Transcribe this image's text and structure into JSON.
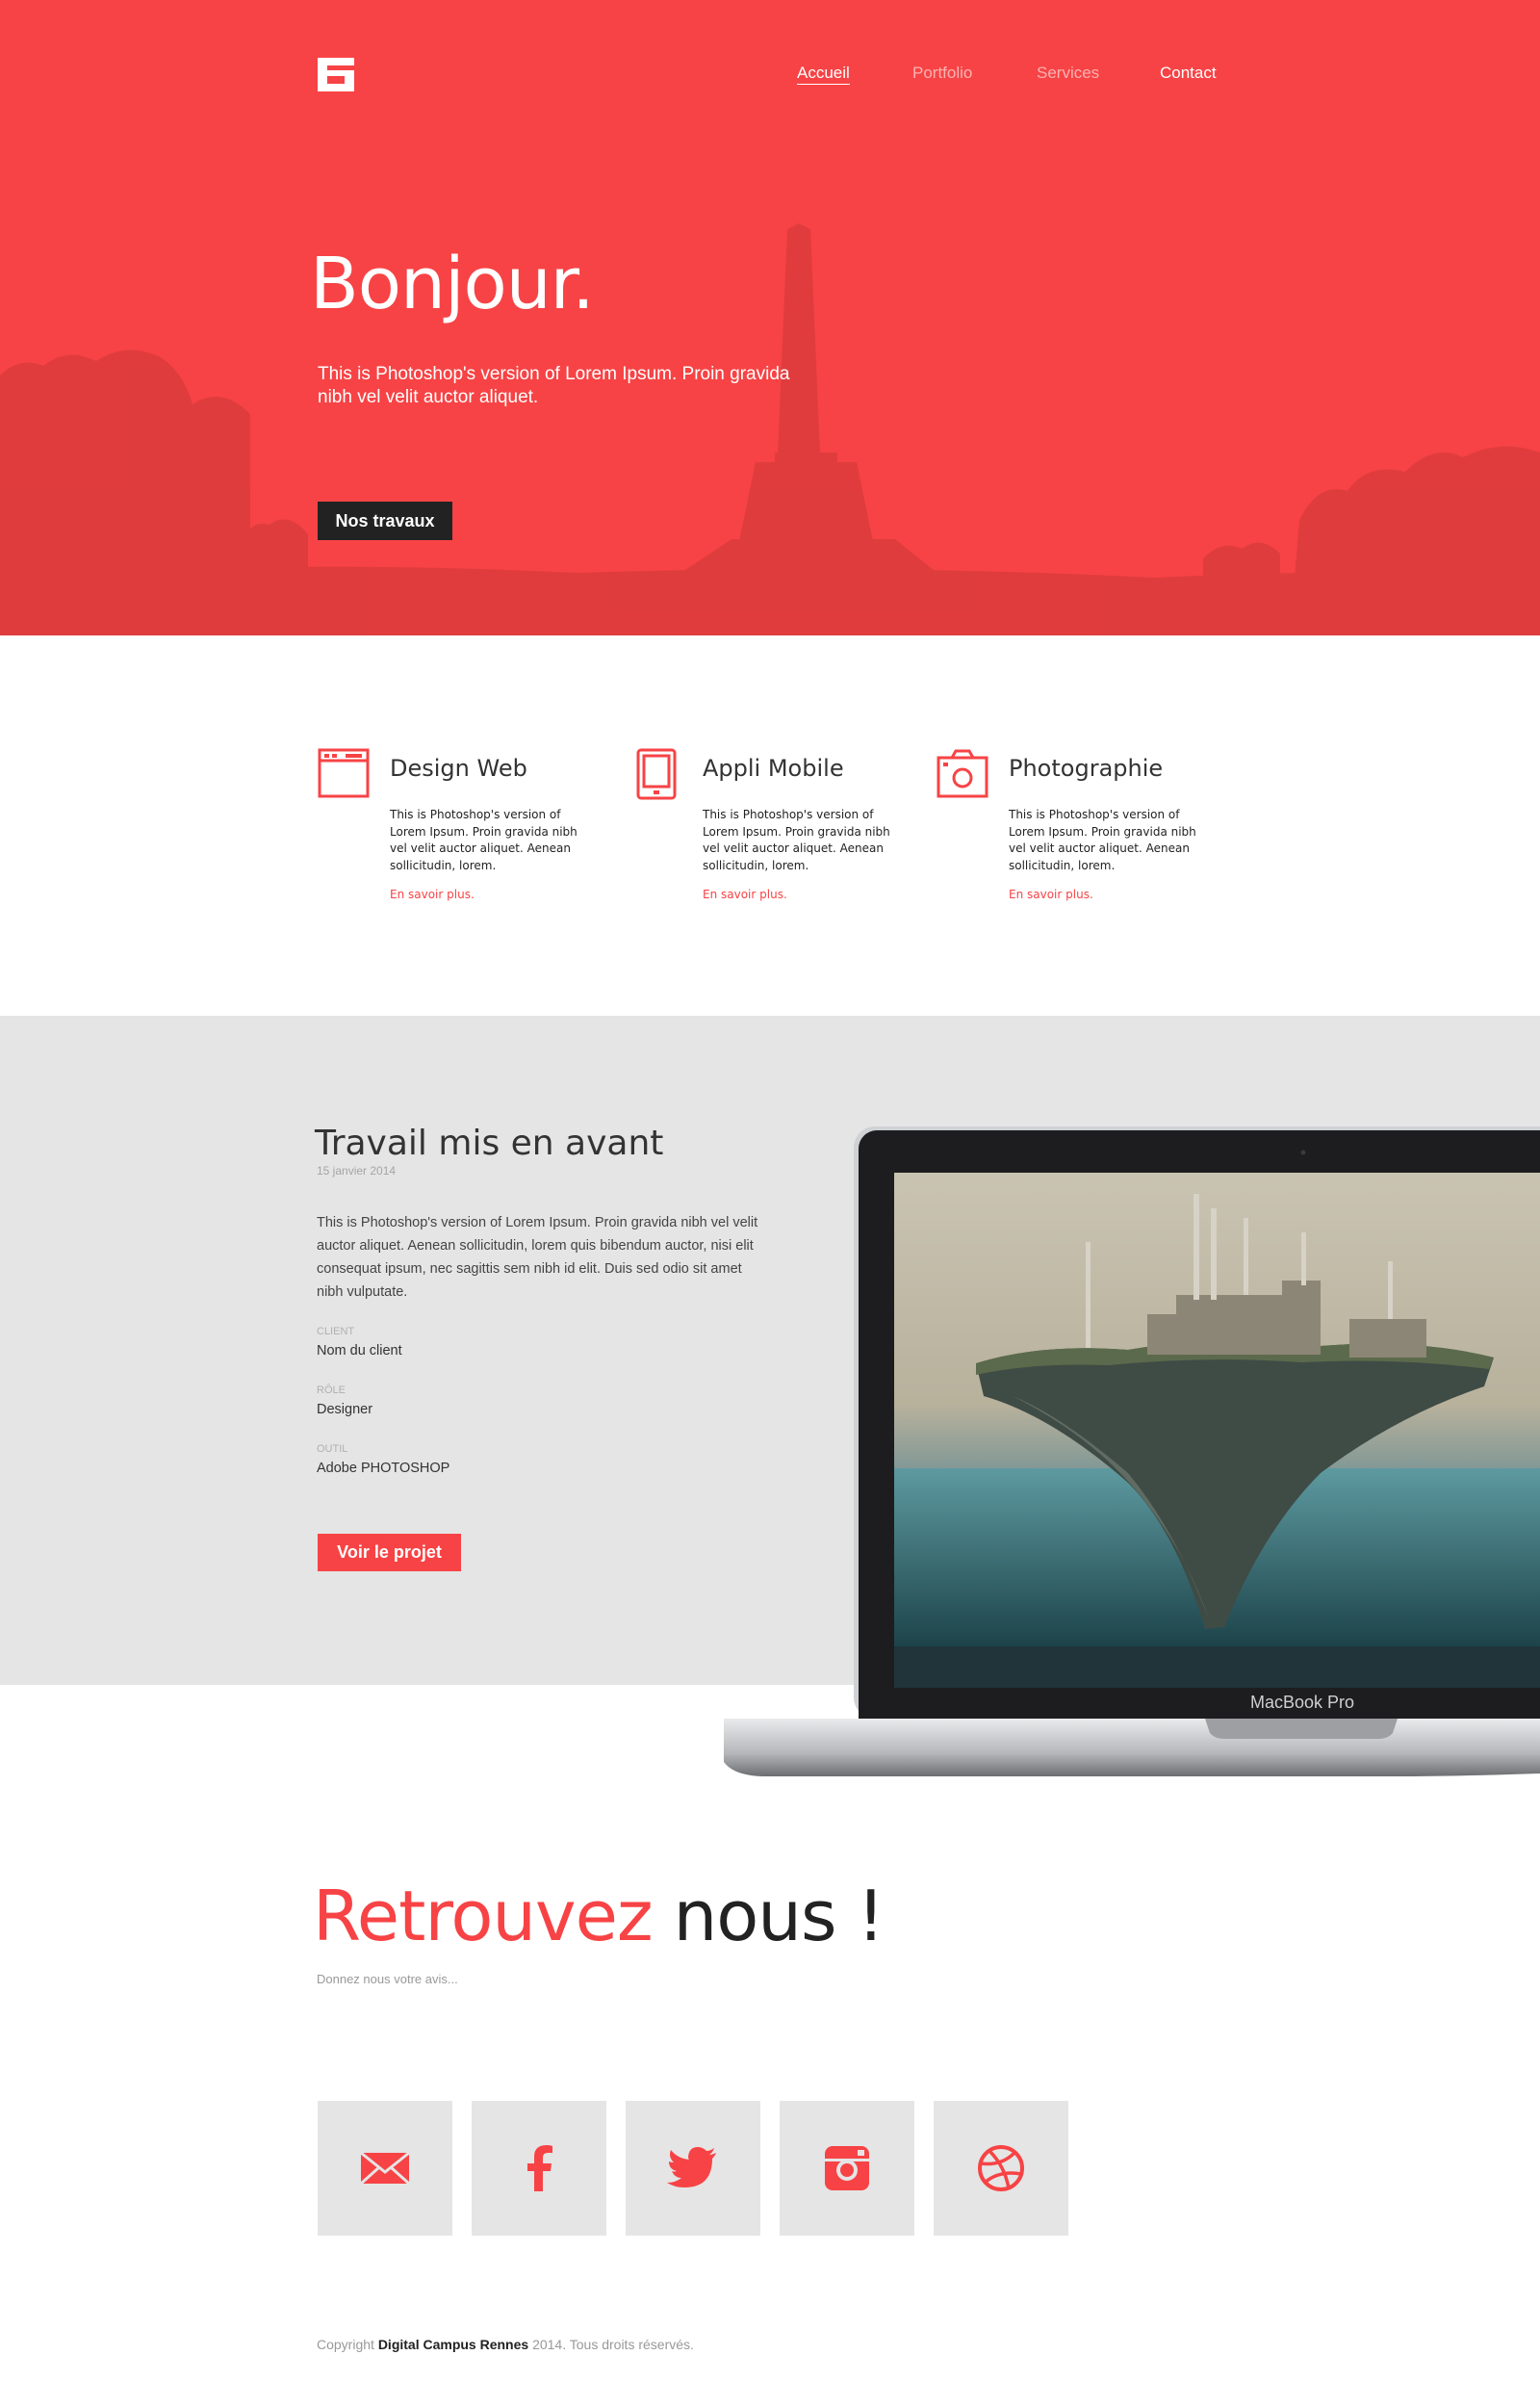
{
  "colors": {
    "accent": "#f74345",
    "dark": "#222222",
    "light_gray": "#e5e5e5"
  },
  "header": {
    "logo_icon": "brand-logo",
    "nav": [
      {
        "label": "Accueil",
        "active": true
      },
      {
        "label": "Portfolio",
        "active": false
      },
      {
        "label": "Services",
        "active": false
      },
      {
        "label": "Contact",
        "active": false
      }
    ]
  },
  "hero": {
    "title": "Bonjour.",
    "text": "This is Photoshop's version  of Lorem Ipsum. Proin gravida nibh vel velit auctor aliquet.",
    "button": "Nos travaux"
  },
  "services": [
    {
      "icon": "browser-window-icon",
      "title": "Design Web",
      "text": "This is Photoshop's version  of Lorem Ipsum. Proin gravida nibh vel velit auctor aliquet. Aenean sollicitudin, lorem.",
      "link": "En savoir plus."
    },
    {
      "icon": "mobile-phone-icon",
      "title": "Appli Mobile",
      "text": "This is Photoshop's version  of Lorem Ipsum. Proin gravida nibh vel velit auctor aliquet. Aenean sollicitudin, lorem.",
      "link": "En savoir plus."
    },
    {
      "icon": "camera-icon",
      "title": "Photographie",
      "text": "This is Photoshop's version  of Lorem Ipsum. Proin gravida nibh vel velit auctor aliquet. Aenean sollicitudin, lorem.",
      "link": "En savoir plus."
    }
  ],
  "featured": {
    "title": "Travail mis en avant",
    "date": "15 janvier 2014",
    "text": "This is Photoshop's version  of Lorem Ipsum. Proin gravida nibh vel velit auctor aliquet. Aenean sollicitudin, lorem quis bibendum auctor, nisi elit consequat ipsum, nec sagittis sem nibh id elit. Duis sed odio sit amet nibh vulputate.",
    "meta": [
      {
        "label": "CLIENT",
        "value": "Nom du client"
      },
      {
        "label": "RÔLE",
        "value": "Designer"
      },
      {
        "label": "OUTIL",
        "value": "Adobe PHOTOSHOP"
      }
    ],
    "button": "Voir le projet",
    "laptop_label": "MacBook Pro"
  },
  "contact": {
    "title_accent": "Retrouvez",
    "title_rest": " nous !",
    "subtitle": "Donnez nous votre avis...",
    "social_icons": [
      "mail-icon",
      "facebook-icon",
      "twitter-icon",
      "instagram-icon",
      "dribbble-icon"
    ]
  },
  "footer": {
    "prefix": "Copyright ",
    "brand": "Digital Campus Rennes",
    "suffix": " 2014. Tous droits réservés."
  }
}
